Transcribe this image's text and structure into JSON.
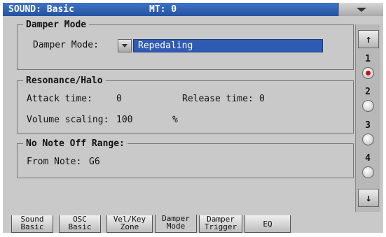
{
  "header": {
    "title": "SOUND: Basic",
    "mt_label": "MT: 0"
  },
  "damper_mode": {
    "section_title": "Damper Mode",
    "field_label": "Damper Mode:",
    "selected_value": "Repedaling"
  },
  "resonance": {
    "section_title": "Resonance/Halo",
    "attack_label": "Attack time:",
    "attack_value": "0",
    "release_label": "Release time:",
    "release_value": "0",
    "volume_label": "Volume scaling:",
    "volume_value": "100",
    "volume_unit": "%"
  },
  "note_off": {
    "section_title": "No Note Off Range:",
    "from_note_label": "From Note:",
    "from_note_value": "G6"
  },
  "scroll": {
    "up_glyph": "↑",
    "down_glyph": "↓",
    "items": [
      {
        "label": "1",
        "selected": true
      },
      {
        "label": "2",
        "selected": false
      },
      {
        "label": "3",
        "selected": false
      },
      {
        "label": "4",
        "selected": false
      }
    ]
  },
  "tabs": [
    {
      "line1": "Sound",
      "line2": "Basic"
    },
    {
      "line1": "OSC",
      "line2": "Basic"
    },
    {
      "line1": "Vel/Key",
      "line2": "Zone"
    },
    {
      "line1": "Damper",
      "line2": "Mode",
      "active": true
    },
    {
      "line1": "Damper",
      "line2": "Trigger"
    },
    {
      "line1": "EQ",
      "line2": ""
    }
  ],
  "colors": {
    "title_bar": "#2f61b6",
    "selected_field": "#2f5bb3",
    "selected_dot": "#c0141a",
    "background": "#c9c9c9"
  }
}
